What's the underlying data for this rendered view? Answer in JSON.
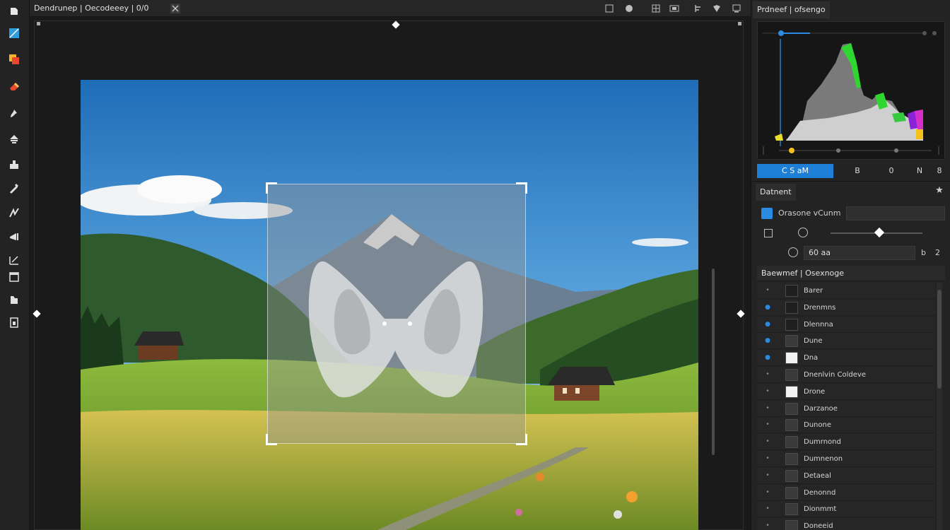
{
  "top_bar": {
    "document_tab": "Dendrunep | Oecodeeey | 0/0",
    "icons": [
      "close-icon",
      "grid-icon",
      "circle-icon",
      "crop-icon",
      "frame-icon",
      "align-icon",
      "shield-icon",
      "screen-icon"
    ]
  },
  "tools": [
    "select-icon",
    "color-icon",
    "eraser-icon",
    "brush-icon",
    "stamp-icon",
    "bucket-icon",
    "pen-icon",
    "path-icon",
    "marker-icon",
    "slice-icon",
    "note-icon",
    "hand-icon",
    "hand2-icon"
  ],
  "histogram_panel": {
    "tab_label": "Prdneef | ofsengo",
    "buttons": [
      "C  S  aM",
      "B",
      "0",
      "N",
      "8"
    ]
  },
  "properties_panel": {
    "tab_label": "Datnent",
    "layer_label": "Orasone vCunm",
    "value_field": "60 aa",
    "nums": [
      "b",
      "2"
    ]
  },
  "layers_panel": {
    "header": "Baewmef | Osexnoge",
    "rows": [
      {
        "name": "Barer",
        "thumb": "dark",
        "visible": false
      },
      {
        "name": "Drenmns",
        "thumb": "dark",
        "visible": true
      },
      {
        "name": "Dlennna",
        "thumb": "dark",
        "visible": true
      },
      {
        "name": "Dune",
        "thumb": "gray",
        "visible": true
      },
      {
        "name": "Dna",
        "thumb": "white",
        "visible": true
      },
      {
        "name": "Dnenlvin Coldeve",
        "thumb": "gray",
        "visible": false
      },
      {
        "name": "Drone",
        "thumb": "white",
        "visible": false
      },
      {
        "name": "Darzanoe",
        "thumb": "gray",
        "visible": false
      },
      {
        "name": "Dunone",
        "thumb": "gray",
        "visible": false
      },
      {
        "name": "Dumrnond",
        "thumb": "gray",
        "visible": false
      },
      {
        "name": "Dumnenon",
        "thumb": "gray",
        "visible": false
      },
      {
        "name": "Detaeal",
        "thumb": "gray",
        "visible": false
      },
      {
        "name": "Denonnd",
        "thumb": "gray",
        "visible": false
      },
      {
        "name": "Dionmmt",
        "thumb": "gray",
        "visible": false
      },
      {
        "name": "Doneeid",
        "thumb": "gray",
        "visible": false
      }
    ]
  },
  "colors": {
    "accent": "#1d7fd6",
    "panel_bg": "#232323",
    "canvas_bg": "#1a1a1a"
  }
}
